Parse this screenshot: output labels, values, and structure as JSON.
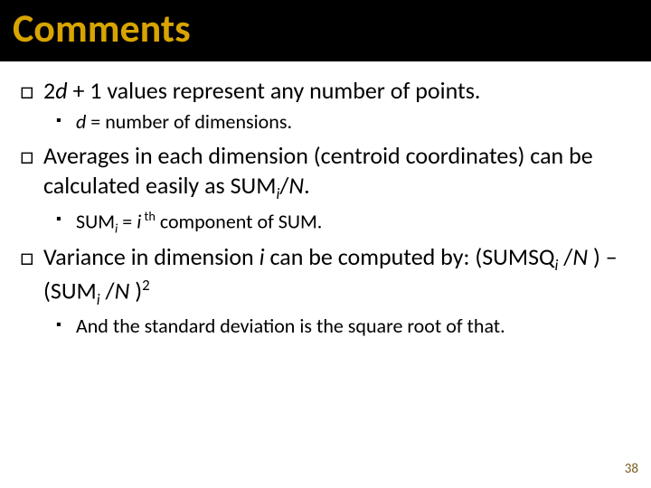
{
  "title": "Comments",
  "bullets": {
    "b1": {
      "glyph": "□",
      "pre": "2",
      "var1": "d",
      "rest": " + 1 values represent any number of points."
    },
    "s1": {
      "glyph": "▪",
      "var": "d",
      "rest": "  = number of dimensions."
    },
    "b2": {
      "glyph": "□",
      "t1": "Averages in each dimension (centroid coordinates) can be calculated easily as SUM",
      "sub": "i",
      "t2": "/",
      "var2": "N",
      "t3": "."
    },
    "s2": {
      "glyph": "▪",
      "t1": " SUM",
      "sub1": "i",
      "t2": " = ",
      "var": "i",
      "sup": " th",
      "t3": " component of SUM."
    },
    "b3": {
      "glyph": "□",
      "t1": "Variance in dimension ",
      "var1": "i",
      "t2": " can be computed by: (SUMSQ",
      "sub1": "i",
      "t3": " /",
      "var2": "N",
      "t4": " ) – (SUM",
      "sub2": "i",
      "t5": " /",
      "var3": "N",
      "t6": " )",
      "sup": "2"
    },
    "s3": {
      "glyph": "▪",
      "text": " And the standard deviation is the square root of that."
    }
  },
  "page_number": "38"
}
